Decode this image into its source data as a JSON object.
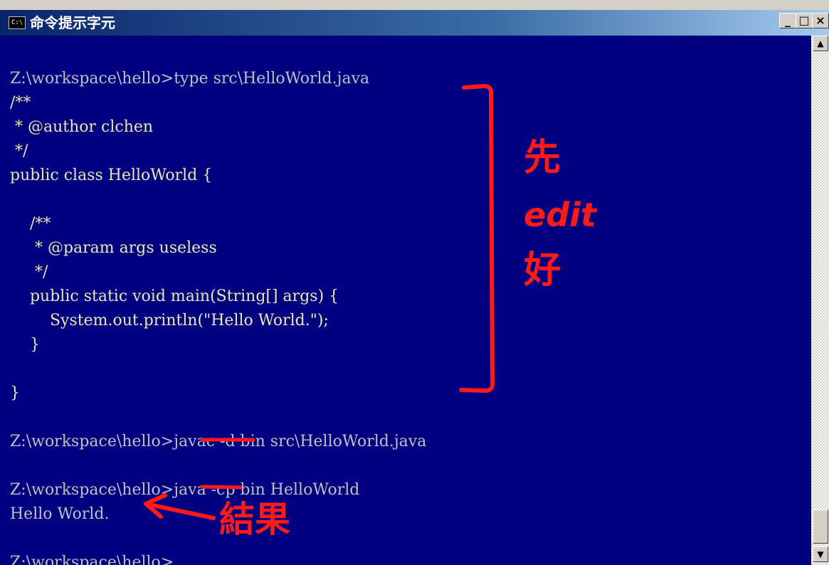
{
  "window": {
    "title": "命令提示字元",
    "icon_label": "C:\\",
    "buttons": {
      "minimize": "_",
      "maximize": "□",
      "close": "×"
    }
  },
  "console": {
    "lines": [
      "Z:\\workspace\\hello>type src\\HelloWorld.java",
      "/**",
      " * @author clchen",
      " */",
      "public class HelloWorld {",
      "",
      "    /**",
      "     * @param args useless",
      "     */",
      "    public static void main(String[] args) {",
      "        System.out.println(\"Hello World.\");",
      "    }",
      "",
      "}",
      "",
      "Z:\\workspace\\hello>javac -d bin src\\HelloWorld.java",
      "",
      "Z:\\workspace\\hello>java -cp bin HelloWorld",
      "Hello World.",
      "",
      "Z:\\workspace\\hello>"
    ]
  },
  "annotations": {
    "edit_note_line1": "先",
    "edit_note_line2": "edit",
    "edit_note_line3": "好",
    "result_note": "結果",
    "color": "#ff1a1a"
  },
  "scrollbar": {
    "up_arrow": "▲",
    "down_arrow": "▼"
  },
  "colors": {
    "terminal_bg": "#000080",
    "text": "#c0c0c0",
    "titlebar": "#0a246a"
  }
}
